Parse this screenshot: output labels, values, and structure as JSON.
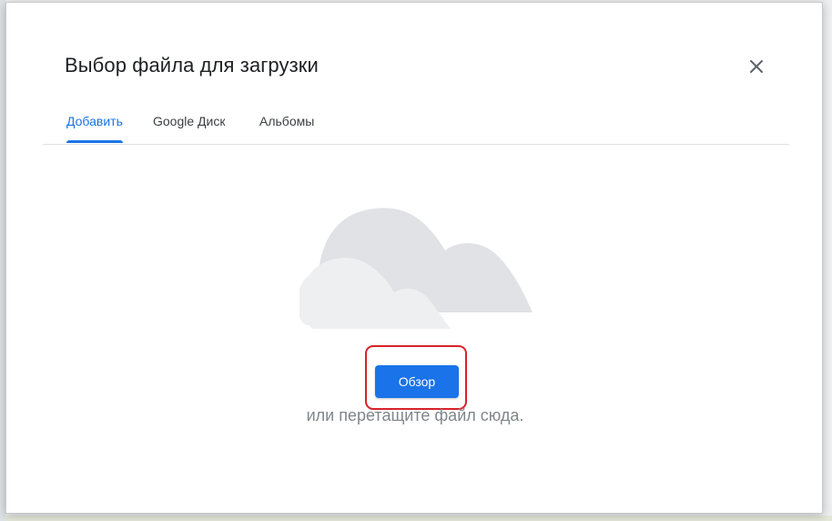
{
  "dialog": {
    "title": "Выбор файла для загрузки",
    "close_icon": "close-icon"
  },
  "tabs": [
    {
      "label": "Добавить",
      "active": true
    },
    {
      "label": "Google Диск",
      "active": false
    },
    {
      "label": "Альбомы",
      "active": false
    }
  ],
  "upload": {
    "illustration_icon": "cloud-icon",
    "browse_label": "Обзор",
    "drop_hint": "или перетащите файл сюда."
  },
  "colors": {
    "accent": "#1a73e8",
    "highlight": "#d8222a",
    "cloud_back": "#e0e1e4",
    "cloud_front": "#eeeff0"
  }
}
